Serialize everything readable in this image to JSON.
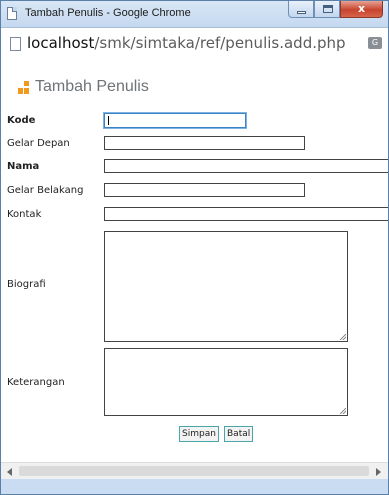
{
  "window": {
    "title": "Tambah Penulis - Google Chrome",
    "close_glyph": "x"
  },
  "address_bar": {
    "host": "localhost",
    "path": "/smk/simtaka/ref/penulis.add.php"
  },
  "page": {
    "heading": "Tambah Penulis"
  },
  "form": {
    "fields": {
      "kode": {
        "label": "Kode",
        "value": ""
      },
      "gelar_depan": {
        "label": "Gelar Depan",
        "value": ""
      },
      "nama": {
        "label": "Nama",
        "value": ""
      },
      "gelar_belakang": {
        "label": "Gelar Belakang",
        "value": ""
      },
      "kontak": {
        "label": "Kontak",
        "value": ""
      },
      "biografi": {
        "label": "Biografi",
        "value": ""
      },
      "keterangan": {
        "label": "Keterangan",
        "value": ""
      }
    },
    "buttons": {
      "save": "Simpan",
      "cancel": "Batal"
    }
  },
  "colors": {
    "logo_orange": "#f29a1e",
    "button_border": "#49a7a9",
    "focus_border": "#3d84c6"
  }
}
